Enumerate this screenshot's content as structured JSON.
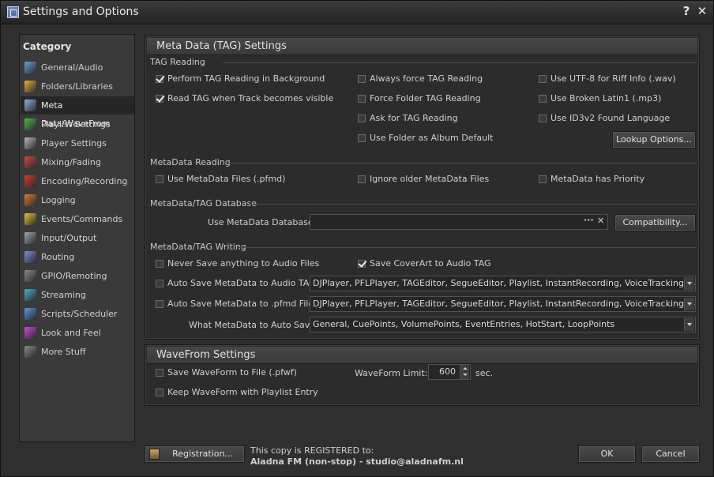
{
  "window": {
    "title": "Settings and Options",
    "help": "?",
    "close": "✕"
  },
  "sidebar": {
    "title": "Category",
    "items": [
      {
        "label": "General/Audio",
        "icon": "music-note-icon",
        "color": "#6aa0d8"
      },
      {
        "label": "Folders/Libraries",
        "icon": "folder-icon",
        "color": "#e3b13c"
      },
      {
        "label": "Meta Data/WaveFrom",
        "icon": "tag-icon",
        "color": "#8ab0e0"
      },
      {
        "label": "Playlist Settings",
        "icon": "play-icon",
        "color": "#4fb84a"
      },
      {
        "label": "Player Settings",
        "icon": "player-icon",
        "color": "#b8b8b8"
      },
      {
        "label": "Mixing/Fading",
        "icon": "mixing-icon",
        "color": "#d04a3a"
      },
      {
        "label": "Encoding/Recording",
        "icon": "record-icon",
        "color": "#d83a2a"
      },
      {
        "label": "Logging",
        "icon": "log-icon",
        "color": "#e07b2a"
      },
      {
        "label": "Events/Commands",
        "icon": "lightning-icon",
        "color": "#e8c33a"
      },
      {
        "label": "Input/Output",
        "icon": "io-icon",
        "color": "#9aa8b8"
      },
      {
        "label": "Routing",
        "icon": "routing-icon",
        "color": "#7d8ce0"
      },
      {
        "label": "GPIO/Remoting",
        "icon": "gpio-icon",
        "color": "#8a8a8a"
      },
      {
        "label": "Streaming",
        "icon": "streaming-icon",
        "color": "#4ab0c8"
      },
      {
        "label": "Scripts/Scheduler",
        "icon": "scripts-icon",
        "color": "#5a9ad8"
      },
      {
        "label": "Look and Feel",
        "icon": "palette-icon",
        "color": "#c84ad8"
      },
      {
        "label": "More Stuff",
        "icon": "more-icon",
        "color": "#8a8a8a"
      }
    ],
    "selected": 2
  },
  "meta": {
    "header": "Meta Data (TAG) Settings",
    "tag_reading": {
      "title": "TAG Reading",
      "col1": [
        {
          "label": "Perform TAG Reading in Background",
          "checked": true
        },
        {
          "label": "Read TAG when Track becomes visible",
          "checked": true
        }
      ],
      "col2": [
        {
          "label": "Always force TAG Reading",
          "checked": false
        },
        {
          "label": "Force Folder TAG Reading",
          "checked": false
        },
        {
          "label": "Ask for TAG Reading",
          "checked": false
        },
        {
          "label": "Use Folder as Album Default",
          "checked": false
        }
      ],
      "col3": [
        {
          "label": "Use UTF-8 for Riff Info (.wav)",
          "checked": false
        },
        {
          "label": "Use Broken Latin1 (.mp3)",
          "checked": false
        },
        {
          "label": "Use ID3v2 Found Language",
          "checked": false
        }
      ],
      "lookup_button": "Lookup Options..."
    },
    "metadata_reading": {
      "title": "MetaData Reading",
      "items": [
        {
          "label": "Use MetaData Files (.pfmd)",
          "checked": false
        },
        {
          "label": "Ignore older MetaData Files",
          "checked": false
        },
        {
          "label": "MetaData has Priority",
          "checked": false
        }
      ]
    },
    "database": {
      "title": "MetaData/TAG Database",
      "label": "Use MetaData Database:",
      "value": "",
      "dots": "···",
      "clear": "✕",
      "compat_button": "Compatibility..."
    },
    "writing": {
      "title": "MetaData/TAG Writing",
      "never_save": {
        "label": "Never Save anything to Audio Files",
        "checked": false
      },
      "save_coverart": {
        "label": "Save CoverArt to Audio TAG",
        "checked": true
      },
      "auto_audio": {
        "label": "Auto Save MetaData to Audio TAG:",
        "checked": false,
        "value": "DJPlayer, PFLPlayer, TAGEditor, SegueEditor, Playlist, InstantRecording, VoiceTracking, Stand..."
      },
      "auto_pfmd": {
        "label": "Auto Save MetaData to .pfmd File:",
        "checked": false,
        "value": "DJPlayer, PFLPlayer, TAGEditor, SegueEditor, Playlist, InstantRecording, VoiceTracking, Stand..."
      },
      "what_label": "What MetaData to Auto Save:",
      "what_value": "General, CuePoints, VolumePoints, EventEntries, HotStart, LoopPoints"
    }
  },
  "wave": {
    "header": "WaveFrom Settings",
    "save_file": {
      "label": "Save WaveForm to File (.pfwf)",
      "checked": false
    },
    "keep": {
      "label": "Keep WaveForm with Playlist Entry",
      "checked": false
    },
    "limit_label": "WaveForm Limit:",
    "limit_value": "600",
    "limit_unit": "sec."
  },
  "footer": {
    "registration_button": "Registration...",
    "reg_line1": "This copy is REGISTERED to:",
    "reg_line2": "Aladna FM (non-stop) - studio@aladnafm.nl",
    "ok": "OK",
    "cancel": "Cancel"
  }
}
